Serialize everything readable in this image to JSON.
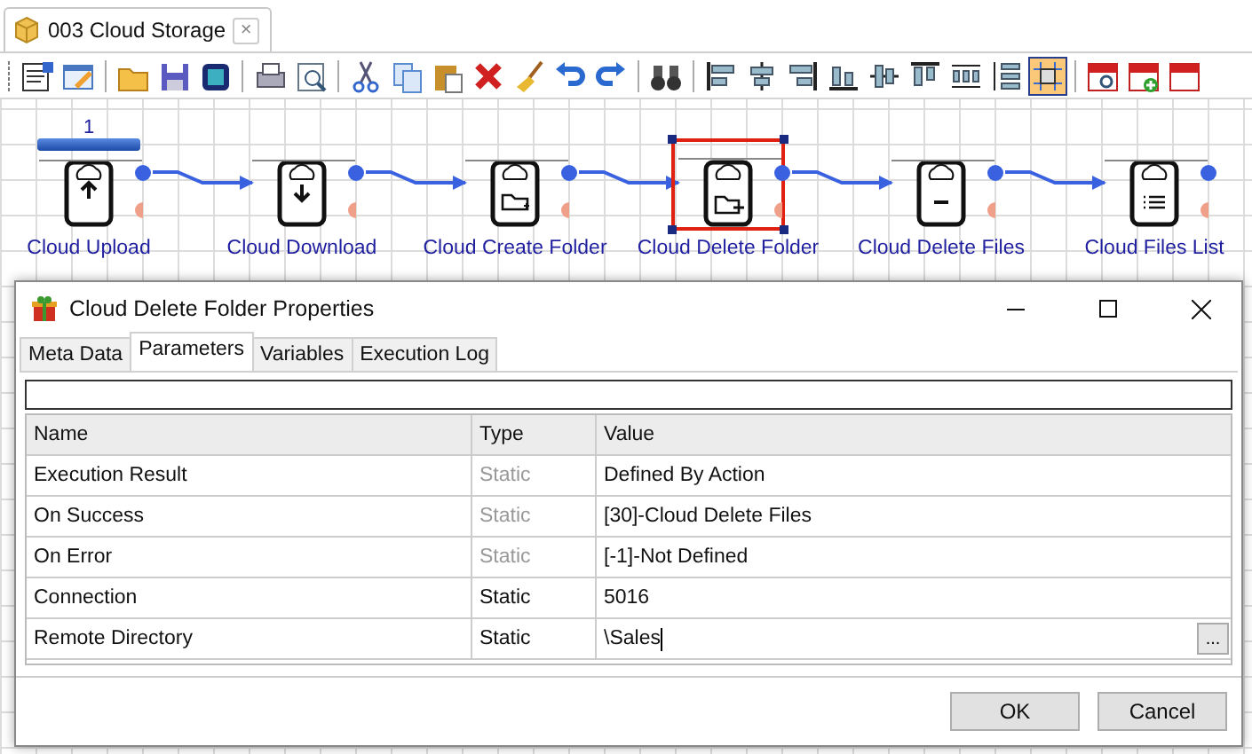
{
  "document_tab": {
    "title": "003 Cloud Storage",
    "close": "×"
  },
  "toolbar_groups": [
    [
      {
        "selected": false
      },
      {
        "selected": false
      }
    ],
    [
      {
        "selected": false
      },
      {
        "selected": false
      },
      {
        "selected": false
      }
    ],
    [
      {
        "selected": false
      },
      {
        "selected": false
      }
    ],
    [
      {
        "selected": false
      },
      {
        "selected": false
      },
      {
        "selected": false
      },
      {
        "selected": false
      },
      {
        "selected": false
      },
      {
        "selected": false
      },
      {
        "selected": false
      }
    ],
    [
      {
        "selected": false
      }
    ],
    [
      {
        "selected": false
      },
      {
        "selected": false
      },
      {
        "selected": false
      },
      {
        "selected": false
      },
      {
        "selected": false
      },
      {
        "selected": false
      },
      {
        "selected": false
      },
      {
        "selected": false
      },
      {
        "selected": true
      }
    ],
    [
      {
        "selected": false
      },
      {
        "selected": false
      },
      {
        "selected": false
      }
    ]
  ],
  "flow": {
    "nodes": [
      {
        "label": "Cloud Upload",
        "kind": "upload",
        "step": "1",
        "level": 1,
        "selected": false
      },
      {
        "label": "Cloud Download",
        "kind": "download",
        "selected": false
      },
      {
        "label": "Cloud Create Folder",
        "kind": "create_folder",
        "selected": false
      },
      {
        "label": "Cloud Delete Folder",
        "kind": "delete_folder",
        "selected": true
      },
      {
        "label": "Cloud Delete Files",
        "kind": "delete_files",
        "selected": false
      },
      {
        "label": "Cloud Files List",
        "kind": "files_list",
        "selected": false
      }
    ]
  },
  "dialog": {
    "title": "Cloud Delete Folder Properties",
    "tabs": [
      {
        "label": "Meta Data",
        "selected": false
      },
      {
        "label": "Parameters",
        "selected": true
      },
      {
        "label": "Variables",
        "selected": false
      },
      {
        "label": "Execution Log",
        "selected": false
      }
    ],
    "table": {
      "columns": [
        "Name",
        "Type",
        "Value"
      ],
      "rows": [
        {
          "name": "Execution Result",
          "type": "Static",
          "type_disabled": true,
          "value": "Defined By Action",
          "editing": false
        },
        {
          "name": "On Success",
          "type": "Static",
          "type_disabled": true,
          "value": "[30]-Cloud Delete Files",
          "editing": false
        },
        {
          "name": "On Error",
          "type": "Static",
          "type_disabled": true,
          "value": "[-1]-Not Defined",
          "editing": false
        },
        {
          "name": "Connection",
          "type": "Static",
          "type_disabled": false,
          "value": "5016",
          "editing": false
        },
        {
          "name": "Remote Directory",
          "type": "Static",
          "type_disabled": false,
          "value": "\\Sales",
          "editing": true,
          "browse_button": "..."
        }
      ]
    },
    "buttons": [
      "OK",
      "Cancel"
    ]
  }
}
